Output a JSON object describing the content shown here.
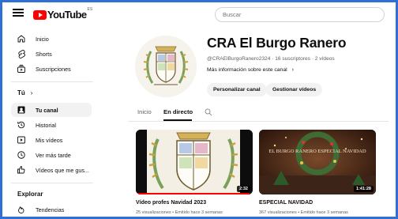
{
  "header": {
    "logo_text": "YouTube",
    "region": "ES",
    "search_placeholder": "Buscar"
  },
  "sidebar": {
    "main": [
      {
        "label": "Inicio",
        "icon": "home-icon"
      },
      {
        "label": "Shorts",
        "icon": "shorts-icon"
      },
      {
        "label": "Suscripciones",
        "icon": "subscriptions-icon"
      }
    ],
    "you_section": {
      "title": "Tú",
      "chevron": "›",
      "items": [
        {
          "label": "Tu canal",
          "icon": "your-channel-icon",
          "active": true
        },
        {
          "label": "Historial",
          "icon": "history-icon"
        },
        {
          "label": "Mis vídeos",
          "icon": "my-videos-icon"
        },
        {
          "label": "Ver más tarde",
          "icon": "watch-later-icon"
        },
        {
          "label": "Vídeos que me gus...",
          "icon": "liked-videos-icon"
        }
      ]
    },
    "explore_section": {
      "title": "Explorar",
      "items": [
        {
          "label": "Tendencias",
          "icon": "trending-icon"
        }
      ]
    }
  },
  "channel": {
    "name": "CRA El Burgo Ranero",
    "meta": "@CRAElBurgoRanero2324 · 16 suscriptores · 2 vídeos",
    "more_info": "Más información sobre este canal",
    "more_info_arrow": "›",
    "buttons": {
      "customize": "Personalizar canal",
      "manage": "Gestionar vídeos"
    }
  },
  "tabs": [
    {
      "label": "Inicio",
      "active": false
    },
    {
      "label": "En directo",
      "active": true
    }
  ],
  "videos": [
    {
      "title": "Vídeo profes Navidad 2023",
      "meta": "25 visualizaciones • Emitido hace 3 semanas",
      "duration": "2:32",
      "watched_fraction": 0.97
    },
    {
      "title": "ESPECIAL NAVIDAD",
      "meta": "367 visualizaciones • Emitido hace 3 semanas",
      "duration": "1:41:28",
      "overlay_text": "EL BURGO RANERO ESPECIAL NAVIDAD",
      "watched_fraction": 0
    }
  ],
  "colors": {
    "brand_red": "#ff0000",
    "frame_blue": "#2f6fd6",
    "pill_bg": "#f2f2f2",
    "secondary_text": "#606060"
  }
}
